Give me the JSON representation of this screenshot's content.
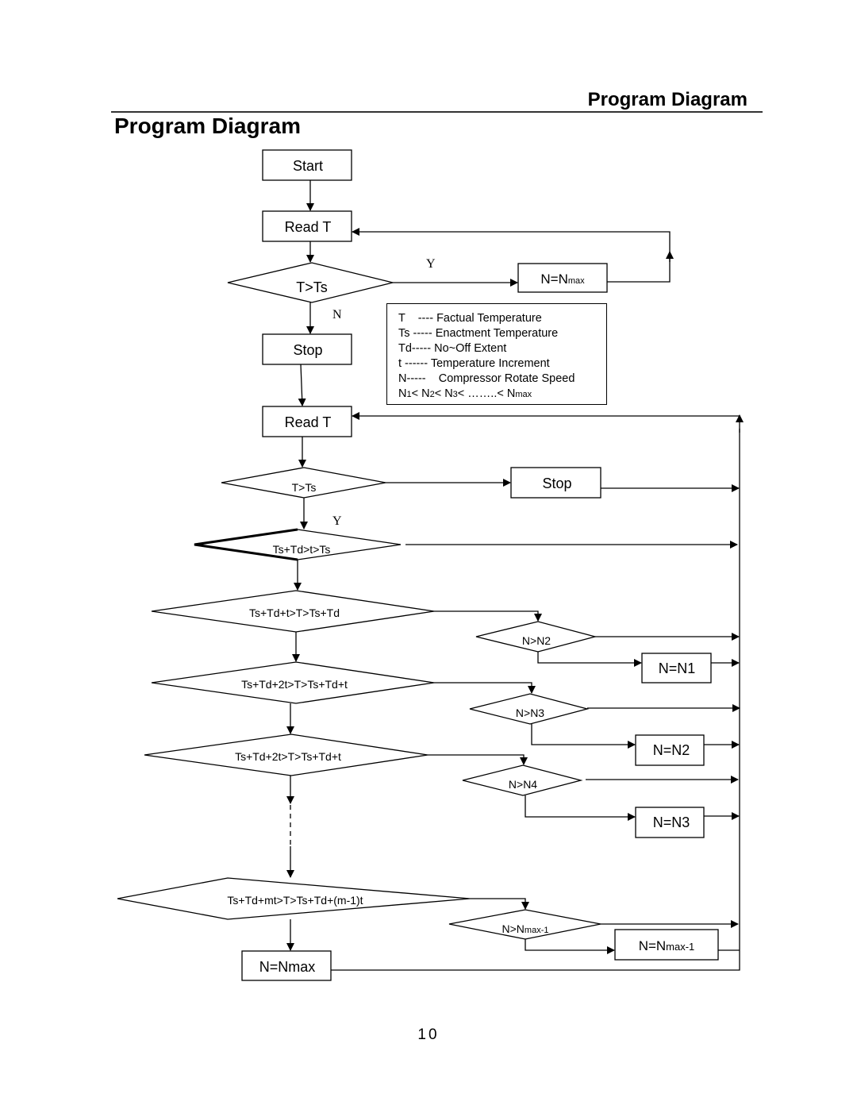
{
  "header": {
    "running_title": "Program Diagram"
  },
  "page_title": "Program Diagram",
  "page_number": "10",
  "legend": {
    "lines": [
      {
        "term": "T",
        "sep": "    ---- ",
        "meaning": "Factual Temperature"
      },
      {
        "term": "Ts",
        "sep": " ----- ",
        "meaning": "Enactment Temperature"
      },
      {
        "term": "Td",
        "sep": "----- ",
        "meaning": "No~Off Extent"
      },
      {
        "term": "t",
        "sep": " ------ ",
        "meaning": "Temperature Increment"
      },
      {
        "term": "N",
        "sep": "-----    ",
        "meaning": "Compressor Rotate Speed"
      }
    ],
    "order": {
      "n1": "N",
      "s1": "1",
      "n2": "< N",
      "s2": "2",
      "n3": "< N",
      "s3": "3",
      "rest": "< ……..< N",
      "smax": "max"
    }
  },
  "nodes": {
    "start": "Start",
    "read_t_1": "Read T",
    "cond_t_gt_ts_1": "T>Ts",
    "n_eq_nmax_top": {
      "base": "N=N",
      "sub": "max"
    },
    "stop_1": "Stop",
    "read_t_2": "Read T",
    "cond_t_gt_ts_2": "T>Ts",
    "stop_2": "Stop",
    "cond_band_0": "Ts+Td>t>Ts",
    "cond_band_1": "Ts+Td+t>T>Ts+Td",
    "cond_n_gt_n2": "N>N2",
    "set_n1": "N=N1",
    "cond_band_2": "Ts+Td+2t>T>Ts+Td+t",
    "cond_n_gt_n3": "N>N3",
    "set_n2": "N=N2",
    "cond_band_3": "Ts+Td+2t>T>Ts+Td+t",
    "cond_n_gt_n4": "N>N4",
    "set_n3": "N=N3",
    "cond_band_m": "Ts+Td+mt>T>Ts+Td+(m-1)t",
    "cond_n_gt_nmax1": {
      "base": "N>N",
      "sub": "max-1"
    },
    "set_nmax1": {
      "base": "N=N",
      "sub": "max-1"
    },
    "set_nmax": "N=Nmax"
  },
  "branch_labels": {
    "yes_top": "Y",
    "no_top": "N",
    "yes_mid": "Y"
  }
}
